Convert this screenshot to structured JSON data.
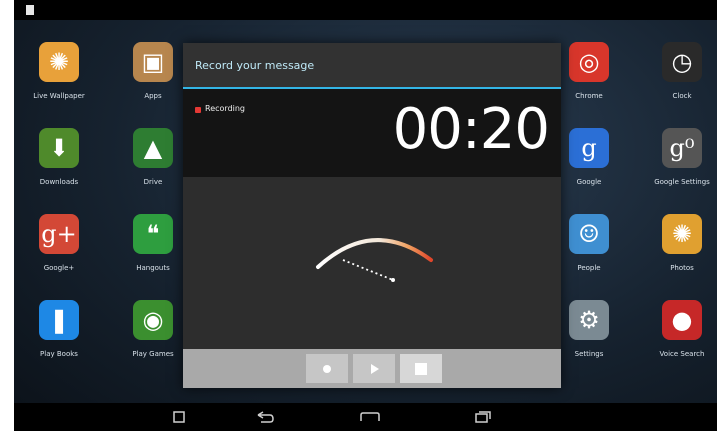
{
  "status_bar": {
    "right_text": ""
  },
  "home_screen": {
    "apps_left": [
      {
        "label": "Live Wallpaper",
        "icon": "pinwheel-icon",
        "color": "#e8a13a"
      },
      {
        "label": "Apps",
        "icon": "package-icon",
        "color": "#b7864e"
      },
      {
        "label": "Downloads",
        "icon": "download-icon",
        "color": "#4f8a2b"
      },
      {
        "label": "Drive",
        "icon": "drive-icon",
        "color": "#2e7d32"
      },
      {
        "label": "Google+",
        "icon": "google-plus-icon",
        "color": "#d34836"
      },
      {
        "label": "Hangouts",
        "icon": "hangouts-icon",
        "color": "#2e9e3f"
      },
      {
        "label": "Play Books",
        "icon": "book-icon",
        "color": "#1e88e5"
      },
      {
        "label": "Play Games",
        "icon": "gamepad-icon",
        "color": "#3b8f2f"
      }
    ],
    "apps_right": [
      {
        "label": "Chrome",
        "icon": "chrome-icon",
        "color": "#d8362b"
      },
      {
        "label": "Clock",
        "icon": "clock-icon",
        "color": "#2a2a2a"
      },
      {
        "label": "Google",
        "icon": "google-g-icon",
        "color": "#2b6fd6"
      },
      {
        "label": "Google Settings",
        "icon": "google-settings-icon",
        "color": "#555555"
      },
      {
        "label": "People",
        "icon": "people-icon",
        "color": "#3f8fd1"
      },
      {
        "label": "Photos",
        "icon": "pinwheel-icon",
        "color": "#e0a030"
      },
      {
        "label": "Settings",
        "icon": "gear-icon",
        "color": "#7b8a93"
      },
      {
        "label": "Voice Search",
        "icon": "microphone-icon",
        "color": "#c62828"
      }
    ]
  },
  "dialog": {
    "title": "Record your message",
    "recording_label": "Recording",
    "timer": "00:20",
    "accent_color": "#33b5e5",
    "controls": {
      "record": "record-icon",
      "play": "play-icon",
      "stop": "stop-icon"
    }
  }
}
